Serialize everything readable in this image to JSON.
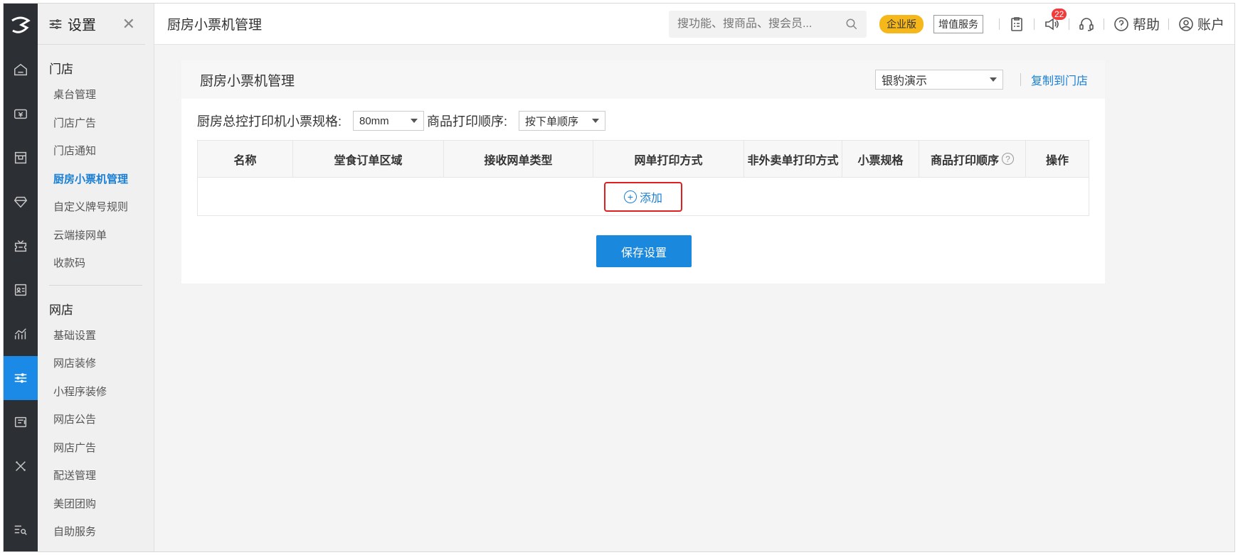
{
  "topbar": {
    "page_title": "厨房小票机管理",
    "search_placeholder": "搜功能、搜商品、搜会员...",
    "edition_badge": "企业版",
    "value_added": "增值服务",
    "notification_count": "22",
    "help_label": "帮助",
    "account_label": "账户"
  },
  "sidebar": {
    "title": "设置",
    "sections": [
      {
        "label": "门店",
        "items": [
          "桌台管理",
          "门店广告",
          "门店通知",
          "厨房小票机管理",
          "自定义牌号规则",
          "云端接网单",
          "收款码"
        ]
      },
      {
        "label": "网店",
        "items": [
          "基础设置",
          "网店装修",
          "小程序装修",
          "网店公告",
          "网店广告",
          "配送管理",
          "美团团购",
          "自助服务"
        ]
      }
    ],
    "active_item": "厨房小票机管理"
  },
  "rail": {
    "icons": [
      "home-icon",
      "cashier-icon",
      "store-icon",
      "diamond-icon",
      "coupon-icon",
      "member-card-icon",
      "chart-icon",
      "settings-sliders-icon",
      "receipt-icon",
      "tools-icon",
      "search-list-icon"
    ],
    "active": "settings-sliders-icon"
  },
  "card": {
    "title": "厨房小票机管理",
    "store_selected": "银豹演示",
    "copy_link": "复制到门店",
    "spec_label": "厨房总控打印机小票规格:",
    "spec_value": "80mm",
    "order_label": "商品打印顺序:",
    "order_value": "按下单顺序",
    "columns": [
      "名称",
      "堂食订单区域",
      "接收网单类型",
      "网单打印方式",
      "非外卖单打印方式",
      "小票规格",
      "商品打印顺序",
      "操作"
    ],
    "add_label": "添加",
    "save_label": "保存设置"
  },
  "colors": {
    "accent": "#1a88dd",
    "rail_bg": "#2c2f33",
    "edition_badge": "#f6b71b",
    "highlight_border": "#e02020"
  }
}
